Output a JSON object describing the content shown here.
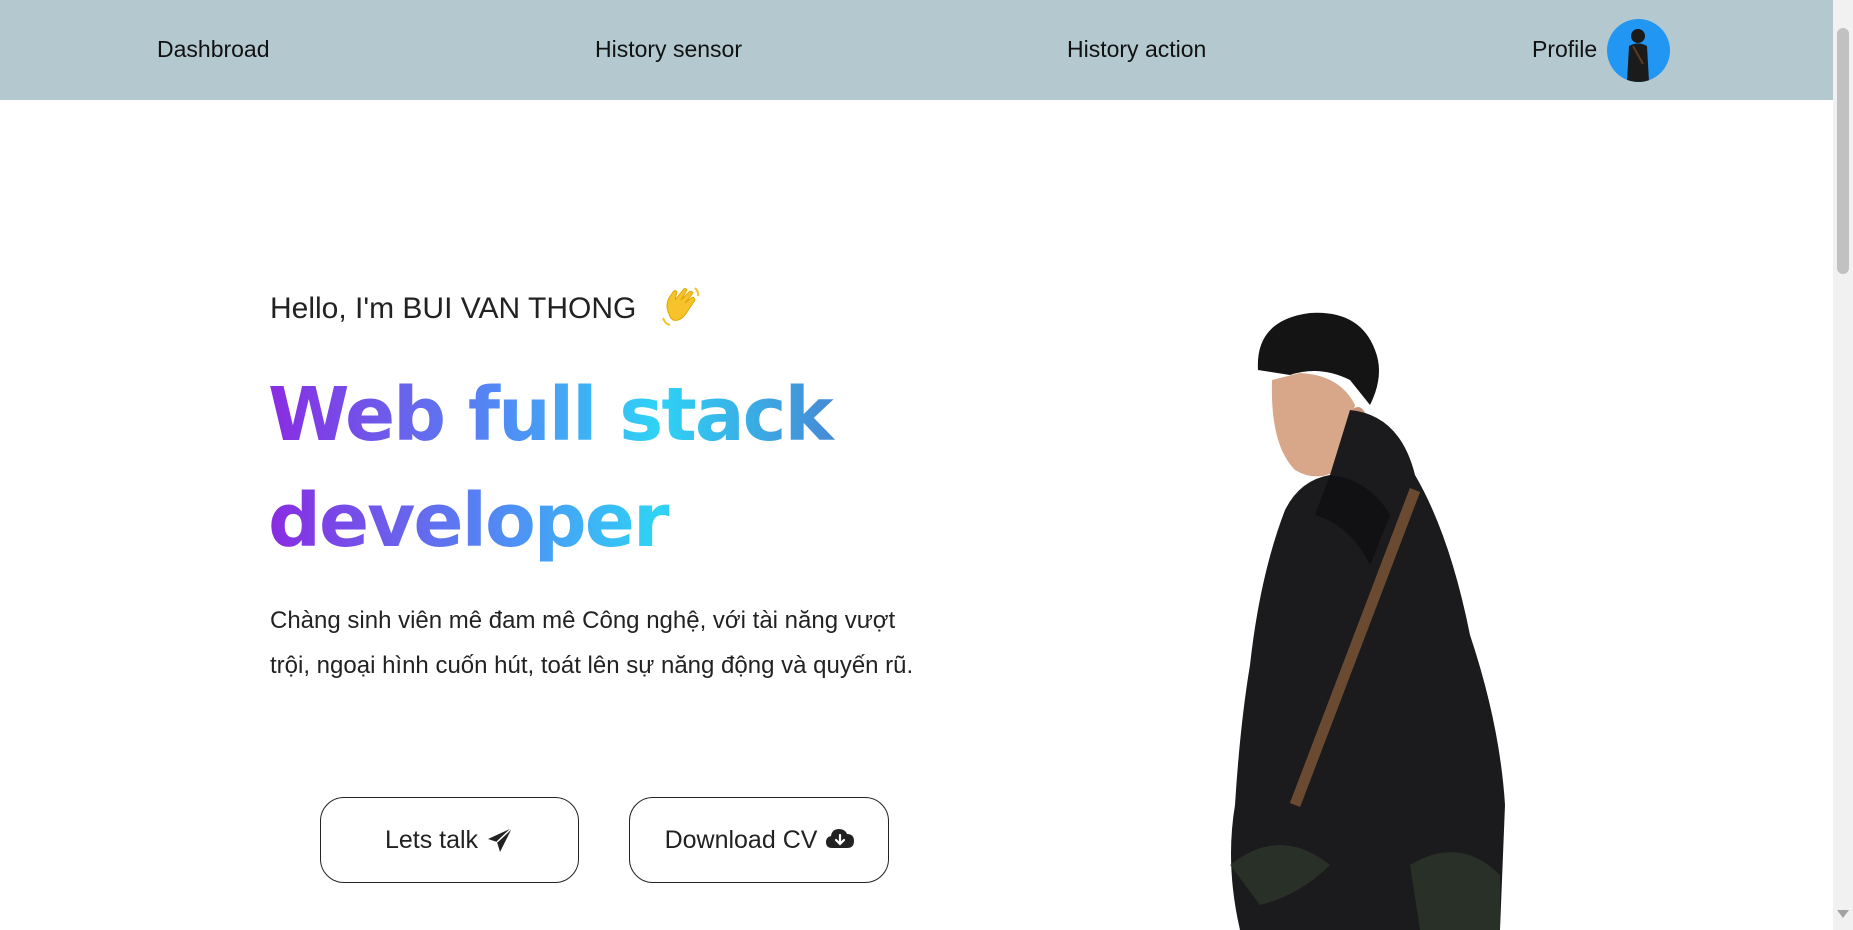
{
  "nav": {
    "dashboard": "Dashbroad",
    "history_sensor": "History sensor",
    "history_action": "History action",
    "profile": "Profile",
    "background_color": "#b3c8cf",
    "avatar_color": "#2196f3"
  },
  "hero": {
    "greeting": "Hello, I'm BUI VAN THONG",
    "greeting_icon": "waving-hand-icon",
    "headline": "Web full stack developer",
    "headline_gradient": [
      "#8a2be2",
      "#4f8ef5",
      "#2ed3f5",
      "#4a7cd0"
    ],
    "description": "Chàng sinh viên mê đam mê Công nghệ, với tài năng vượt trội, ngoại hình cuốn hút, toát lên sự năng động và quyến rũ."
  },
  "buttons": {
    "talk_label": "Lets talk",
    "talk_icon": "paper-plane-icon",
    "cv_label": "Download CV",
    "cv_icon": "cloud-download-icon"
  }
}
